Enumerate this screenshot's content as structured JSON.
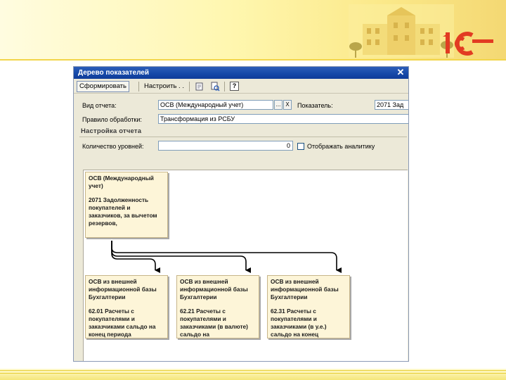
{
  "window": {
    "title": "Дерево показателей",
    "close_glyph": "✕"
  },
  "toolbar": {
    "generate_label": "Сформировать",
    "settings_label": "Настроить . .",
    "help_label": "?"
  },
  "form": {
    "report_type_label": "Вид отчета:",
    "report_type_value": "ОСВ (Международный учет)",
    "select_button": "...",
    "clear_button": "X",
    "indicator_label": "Показатель:",
    "indicator_value": "2071 Зад",
    "rule_label": "Правило обработки:",
    "rule_value": "Трансформация из РСБУ",
    "section_title": "Настройка отчета",
    "levels_label": "Количество уровней:",
    "levels_value": "0",
    "show_analytics_label": "Отображать аналитику",
    "show_analytics_checked": false
  },
  "tree": {
    "root": {
      "title": "ОСВ (Международный учет)",
      "text": "2071 Задолженность покупателей и заказчиков, за вычетом резервов,"
    },
    "children": [
      {
        "title": "ОСВ из внешней информационной базы Бухгалтерии",
        "text": "62.01 Расчеты с покупателями и заказчиками сальдо на конец периода"
      },
      {
        "title": "ОСВ из внешней информационной базы Бухгалтерии",
        "text": "62.21 Расчеты с покупателями и заказчиками (в валюте) сальдо на"
      },
      {
        "title": "ОСВ из внешней информационной базы Бухгалтерии",
        "text": "62.31 Расчеты с покупателями и заказчиками (в у.е.) сальдо на конец"
      }
    ]
  },
  "colors": {
    "node_fill": "#fdf5d8",
    "connector": "#000000",
    "titlebar": "#1548a8",
    "banner": "#fff7b0"
  }
}
